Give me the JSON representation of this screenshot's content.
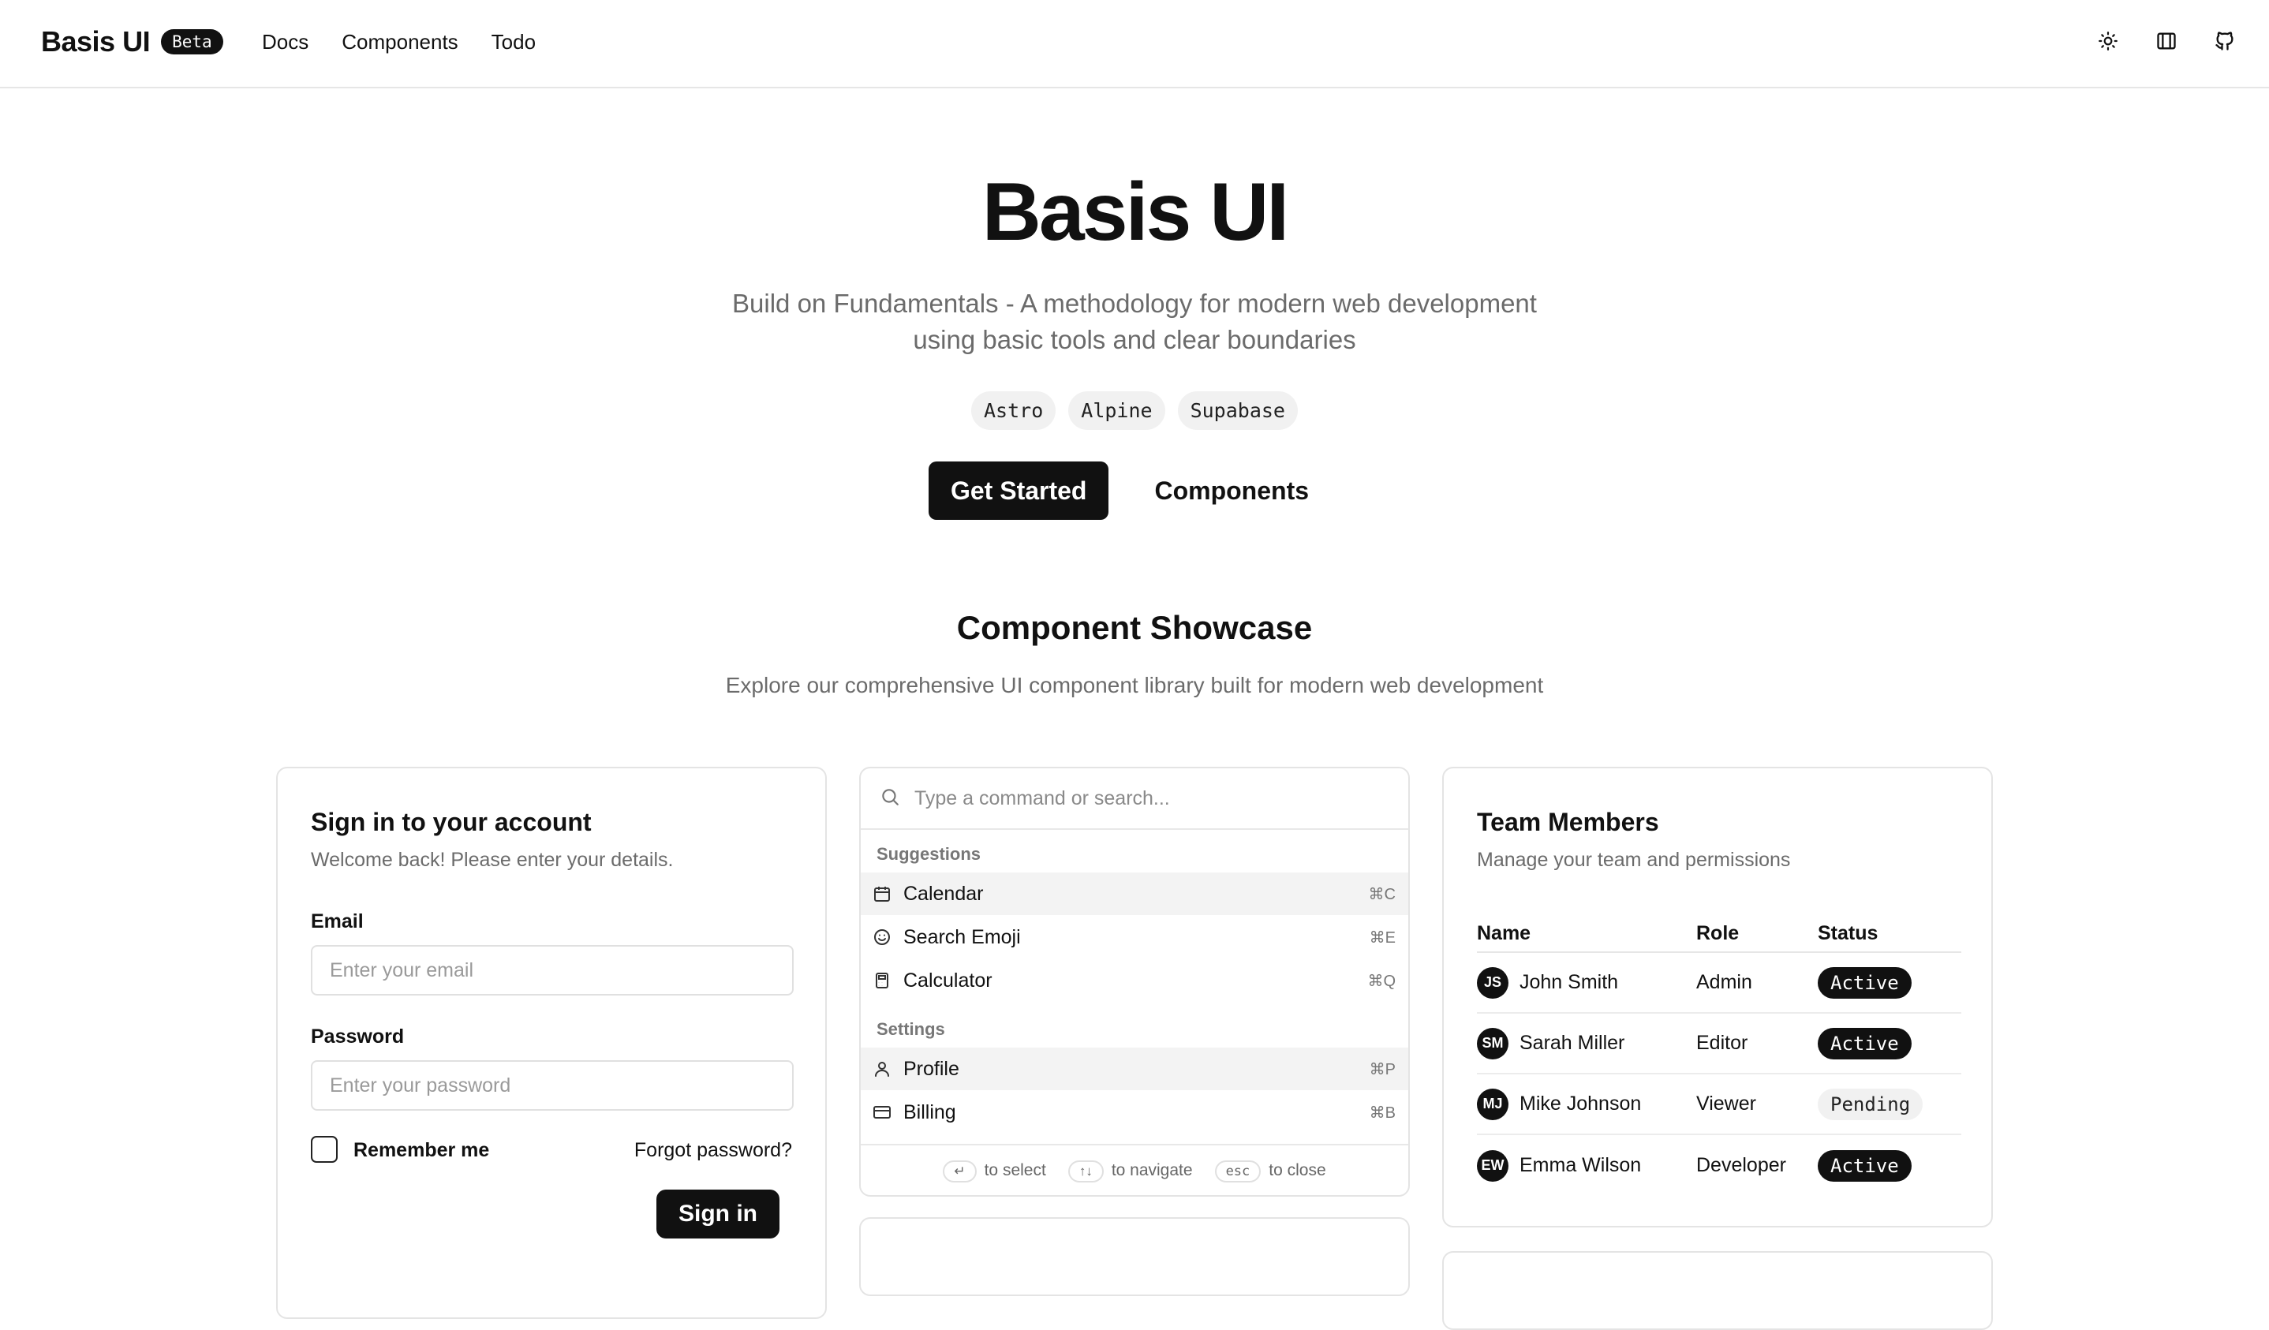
{
  "nav": {
    "brand": "Basis UI",
    "badge": "Beta",
    "links": [
      "Docs",
      "Components",
      "Todo"
    ],
    "icons": [
      "sun-icon",
      "sidebar-icon",
      "github-icon"
    ]
  },
  "hero": {
    "title": "Basis UI",
    "subtitle_line1": "Build on Fundamentals - A methodology for modern web development",
    "subtitle_line2": "using basic tools and clear boundaries",
    "tags": [
      "Astro",
      "Alpine",
      "Supabase"
    ],
    "primary_cta": "Get Started",
    "secondary_cta": "Components"
  },
  "showcase": {
    "title": "Component Showcase",
    "subtitle": "Explore our comprehensive UI component library built for modern web development"
  },
  "signin": {
    "title": "Sign in to your account",
    "description": "Welcome back! Please enter your details.",
    "email_label": "Email",
    "email_placeholder": "Enter your email",
    "password_label": "Password",
    "password_placeholder": "Enter your password",
    "remember": "Remember me",
    "forgot": "Forgot password?",
    "submit": "Sign in"
  },
  "command": {
    "placeholder": "Type a command or search...",
    "groups": [
      {
        "label": "Suggestions",
        "items": [
          {
            "label": "Calendar",
            "shortcut": "⌘C",
            "icon": "calendar-icon"
          },
          {
            "label": "Search Emoji",
            "shortcut": "⌘E",
            "icon": "smile-icon"
          },
          {
            "label": "Calculator",
            "shortcut": "⌘Q",
            "icon": "calculator-icon"
          }
        ]
      },
      {
        "label": "Settings",
        "items": [
          {
            "label": "Profile",
            "shortcut": "⌘P",
            "icon": "user-icon"
          },
          {
            "label": "Billing",
            "shortcut": "⌘B",
            "icon": "credit-card-icon"
          }
        ]
      }
    ],
    "footer": [
      {
        "key": "↵",
        "text": "to select"
      },
      {
        "key": "↑↓",
        "text": "to navigate"
      },
      {
        "key": "esc",
        "text": "to close"
      }
    ]
  },
  "team": {
    "title": "Team Members",
    "description": "Manage your team and permissions",
    "columns": [
      "Name",
      "Role",
      "Status"
    ],
    "rows": [
      {
        "initials": "JS",
        "name": "John Smith",
        "role": "Admin",
        "status": "Active"
      },
      {
        "initials": "SM",
        "name": "Sarah Miller",
        "role": "Editor",
        "status": "Active"
      },
      {
        "initials": "MJ",
        "name": "Mike Johnson",
        "role": "Viewer",
        "status": "Pending"
      },
      {
        "initials": "EW",
        "name": "Emma Wilson",
        "role": "Developer",
        "status": "Active"
      }
    ]
  }
}
